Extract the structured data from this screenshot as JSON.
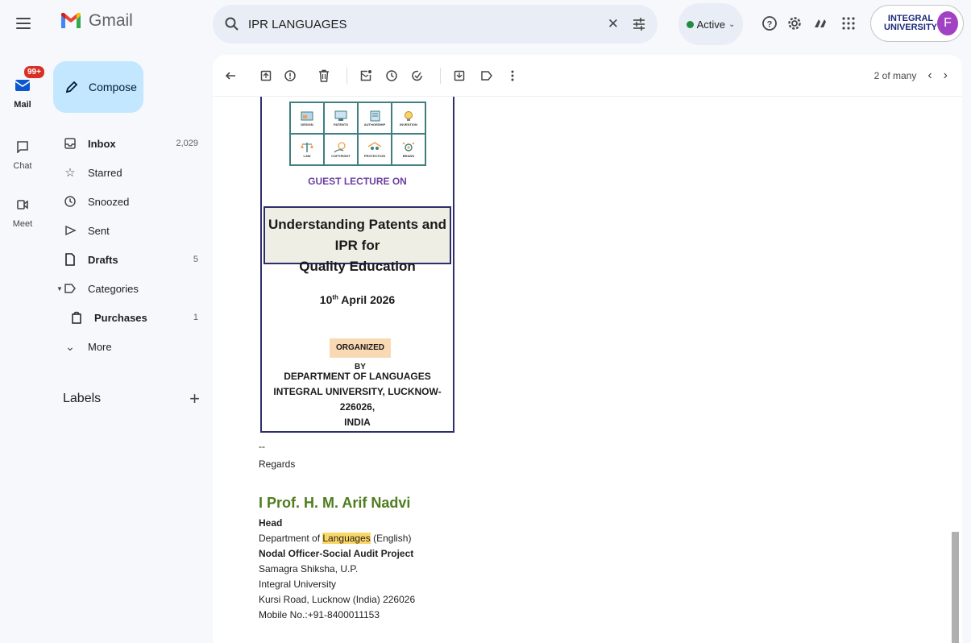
{
  "app": {
    "name": "Gmail"
  },
  "search": {
    "value": "IPR LANGUAGES"
  },
  "status": {
    "label": "Active",
    "color": "#1e8e3e"
  },
  "account": {
    "org_line1": "INTEGRAL",
    "org_line2": "UNIVERSITY",
    "avatar_letter": "F"
  },
  "rail": {
    "mail": {
      "label": "Mail",
      "badge": "99+"
    },
    "chat": {
      "label": "Chat"
    },
    "meet": {
      "label": "Meet"
    }
  },
  "compose": {
    "label": "Compose"
  },
  "nav": {
    "inbox": {
      "label": "Inbox",
      "count": "2,029"
    },
    "starred": {
      "label": "Starred"
    },
    "snoozed": {
      "label": "Snoozed"
    },
    "sent": {
      "label": "Sent"
    },
    "drafts": {
      "label": "Drafts",
      "count": "5"
    },
    "categories": {
      "label": "Categories"
    },
    "purchases": {
      "label": "Purchases",
      "count": "1"
    },
    "more": {
      "label": "More"
    }
  },
  "labels": {
    "heading": "Labels",
    "add": "+"
  },
  "pager": {
    "text": "2 of many"
  },
  "poster": {
    "icons": [
      {
        "caption": "DESIGN"
      },
      {
        "caption": "PATENTS"
      },
      {
        "caption": "AUTHORSHIP"
      },
      {
        "caption": "INVENTION"
      },
      {
        "caption": "LAW"
      },
      {
        "caption": "COPYRIGHT"
      },
      {
        "caption": "PROTECTION"
      },
      {
        "caption": "BRAND"
      }
    ],
    "guest": "GUEST LECTURE  ON",
    "title_line1": "Understanding Patents and IPR for",
    "title_line2": "Quality Education",
    "date_day": "10",
    "date_suffix": "th",
    "date_rest": " April 2026",
    "organized_by": "ORGANIZED BY",
    "dept_line1": "DEPARTMENT OF LANGUAGES",
    "dept_line2": "INTEGRAL UNIVERSITY, LUCKNOW-226026,",
    "dept_line3": "INDIA"
  },
  "signature": {
    "dash": "--",
    "regards": "Regards",
    "name": "I Prof. H. M. Arif Nadvi",
    "role": "Head",
    "dept_prefix": "Department of ",
    "dept_highlight": "Languages",
    "dept_suffix": " (English)",
    "nodal": "Nodal Officer-Social Audit Project",
    "line1": "Samagra Shiksha, U.P.",
    "line2": "Integral University",
    "line3": "Kursi Road, Lucknow (India) 226026",
    "line4": "Mobile No.:+91-8400011153"
  }
}
